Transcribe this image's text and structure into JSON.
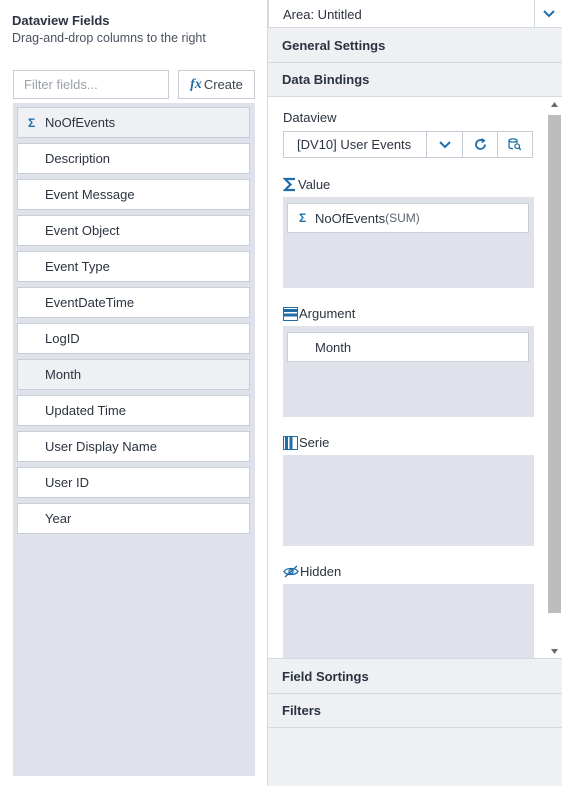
{
  "left": {
    "title": "Dataview Fields",
    "subtitle": "Drag-and-drop columns to the right",
    "filter_placeholder": "Filter fields...",
    "create_label": "Create",
    "fx_glyph": "fx",
    "sigma_glyph": "Σ",
    "fields": [
      {
        "label": "NoOfEvents",
        "measure": true,
        "selected": true
      },
      {
        "label": "Description",
        "measure": false,
        "selected": false
      },
      {
        "label": "Event Message",
        "measure": false,
        "selected": false
      },
      {
        "label": "Event Object",
        "measure": false,
        "selected": false
      },
      {
        "label": "Event Type",
        "measure": false,
        "selected": false
      },
      {
        "label": "EventDateTime",
        "measure": false,
        "selected": false
      },
      {
        "label": "LogID",
        "measure": false,
        "selected": false
      },
      {
        "label": "Month",
        "measure": false,
        "selected": true
      },
      {
        "label": "Updated Time",
        "measure": false,
        "selected": false
      },
      {
        "label": "User Display Name",
        "measure": false,
        "selected": false
      },
      {
        "label": "User ID",
        "measure": false,
        "selected": false
      },
      {
        "label": "Year",
        "measure": false,
        "selected": false
      }
    ]
  },
  "right": {
    "area_label": "Area: Untitled",
    "sections": {
      "general": "General Settings",
      "bindings": "Data Bindings",
      "sortings": "Field Sortings",
      "filters": "Filters"
    },
    "dataview_label": "Dataview",
    "dataview_value": "[DV10] User Events",
    "value_label": "Value",
    "value_item": "NoOfEvents",
    "value_agg": "(SUM)",
    "argument_label": "Argument",
    "argument_item": "Month",
    "serie_label": "Serie",
    "hidden_label": "Hidden"
  },
  "colors": {
    "accent": "#1f6ea8",
    "dropzone_bg": "#dfe2ea",
    "panel_bg": "#eef0f4"
  }
}
